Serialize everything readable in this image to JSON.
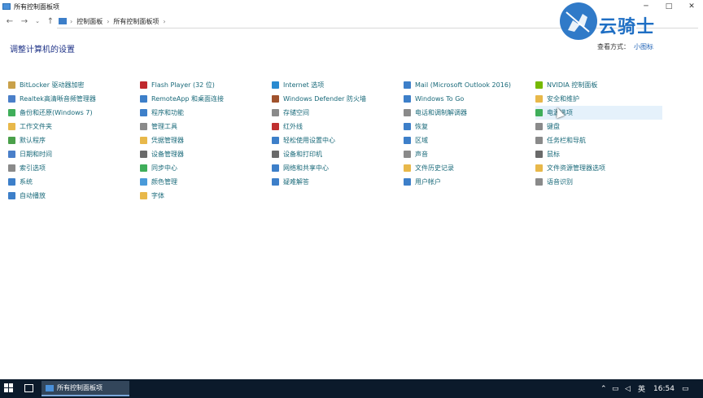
{
  "window": {
    "title": "所有控制面板项"
  },
  "address": {
    "crumbs": [
      "控制面板",
      "所有控制面板项"
    ]
  },
  "watermark": {
    "text": "云骑士"
  },
  "main": {
    "heading": "调整计算机的设置",
    "view_by_label": "查看方式：",
    "view_by_value": "小图标"
  },
  "columns": [
    [
      {
        "label": "BitLocker 驱动器加密",
        "color": "#c9a14a"
      },
      {
        "label": "Realtek高清晰音频管理器",
        "color": "#4a7fc9"
      },
      {
        "label": "备份和还原(Windows 7)",
        "color": "#3fae5a"
      },
      {
        "label": "工作文件夹",
        "color": "#e8b84a"
      },
      {
        "label": "默认程序",
        "color": "#4aa04a"
      },
      {
        "label": "日期和时间",
        "color": "#4a7fc9"
      },
      {
        "label": "索引选项",
        "color": "#8a8a8a"
      },
      {
        "label": "系统",
        "color": "#3d7fc9"
      },
      {
        "label": "自动播放",
        "color": "#3d7fc9"
      }
    ],
    [
      {
        "label": "Flash Player (32 位)",
        "color": "#c0282d"
      },
      {
        "label": "RemoteApp 和桌面连接",
        "color": "#3d7fc9"
      },
      {
        "label": "程序和功能",
        "color": "#3d7fc9"
      },
      {
        "label": "管理工具",
        "color": "#8a8a8a"
      },
      {
        "label": "凭据管理器",
        "color": "#e8b84a"
      },
      {
        "label": "设备管理器",
        "color": "#6a6a6a"
      },
      {
        "label": "同步中心",
        "color": "#3fae5a"
      },
      {
        "label": "颜色管理",
        "color": "#4a9ad9"
      },
      {
        "label": "字体",
        "color": "#e8b84a"
      }
    ],
    [
      {
        "label": "Internet 选项",
        "color": "#2a8ad0"
      },
      {
        "label": "Windows Defender 防火墙",
        "color": "#a0522d"
      },
      {
        "label": "存储空间",
        "color": "#8a8a8a"
      },
      {
        "label": "红外线",
        "color": "#c03030"
      },
      {
        "label": "轻松使用设置中心",
        "color": "#3d7fc9"
      },
      {
        "label": "设备和打印机",
        "color": "#6a6a6a"
      },
      {
        "label": "网络和共享中心",
        "color": "#3d7fc9"
      },
      {
        "label": "疑难解答",
        "color": "#3d7fc9"
      }
    ],
    [
      {
        "label": "Mail (Microsoft Outlook 2016)",
        "color": "#3d7fc9"
      },
      {
        "label": "Windows To Go",
        "color": "#3d7fc9"
      },
      {
        "label": "电话和调制解调器",
        "color": "#8a8a8a"
      },
      {
        "label": "恢复",
        "color": "#3d7fc9"
      },
      {
        "label": "区域",
        "color": "#3d7fc9"
      },
      {
        "label": "声音",
        "color": "#8a8a8a"
      },
      {
        "label": "文件历史记录",
        "color": "#e8b84a"
      },
      {
        "label": "用户帐户",
        "color": "#3d7fc9"
      }
    ],
    [
      {
        "label": "NVIDIA 控制面板",
        "color": "#76b900"
      },
      {
        "label": "安全和维护",
        "color": "#e8b84a"
      },
      {
        "label": "电源选项",
        "color": "#3fae5a",
        "highlight": true
      },
      {
        "label": "键盘",
        "color": "#8a8a8a"
      },
      {
        "label": "任务栏和导航",
        "color": "#8a8a8a"
      },
      {
        "label": "鼠标",
        "color": "#6a6a6a"
      },
      {
        "label": "文件资源管理器选项",
        "color": "#e8b84a"
      },
      {
        "label": "语音识别",
        "color": "#8a8a8a"
      }
    ]
  ],
  "taskbar": {
    "app_label": "所有控制面板项",
    "ime": "英",
    "time": "16:54"
  }
}
